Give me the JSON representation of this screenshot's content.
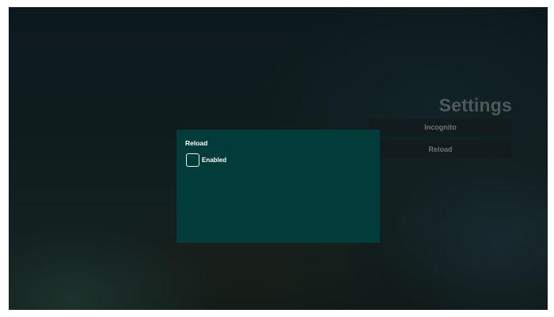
{
  "settings": {
    "title": "Settings",
    "menu": [
      {
        "label": "Incognito"
      },
      {
        "label": "Reload"
      }
    ]
  },
  "dialog": {
    "title": "Reload",
    "option": {
      "label": "Enabled",
      "checked": false
    }
  },
  "colors": {
    "dialog_background": "#023c3a",
    "title_text": "#50585a",
    "menu_text": "#6c7476"
  }
}
